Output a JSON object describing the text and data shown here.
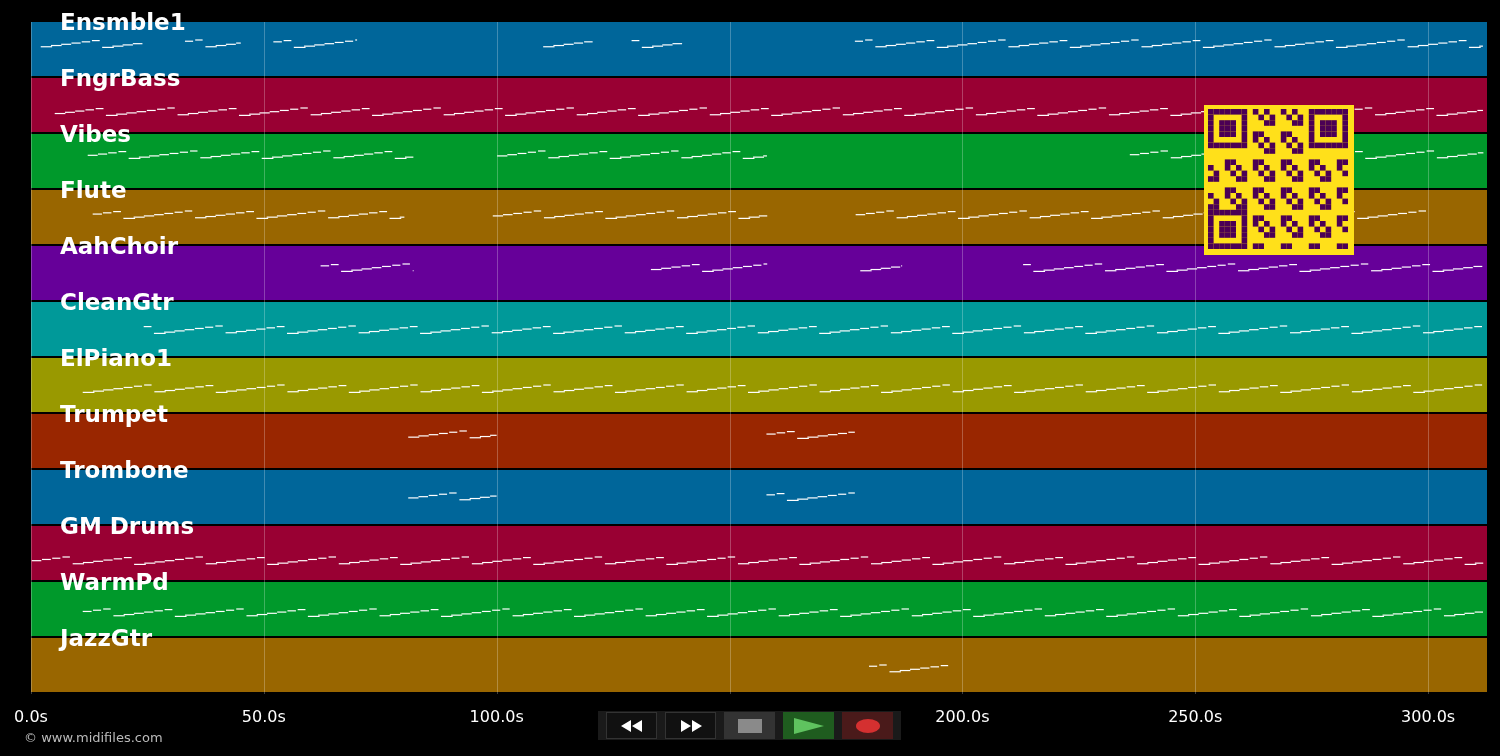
{
  "tracks": [
    {
      "name": "Ensmble1",
      "color": "#00669a"
    },
    {
      "name": "FngrBass",
      "color": "#990033"
    },
    {
      "name": "Vibes",
      "color": "#00992b"
    },
    {
      "name": "Flute",
      "color": "#996600"
    },
    {
      "name": "AahChoir",
      "color": "#660099"
    },
    {
      "name": "CleanGtr",
      "color": "#009999"
    },
    {
      "name": "ElPiano1",
      "color": "#999900"
    },
    {
      "name": "Trumpet",
      "color": "#992600"
    },
    {
      "name": "Trombone",
      "color": "#00669a"
    },
    {
      "name": "GM Drums",
      "color": "#990033"
    },
    {
      "name": "WarmPd",
      "color": "#00992b"
    },
    {
      "name": "JazzGtr",
      "color": "#996600"
    }
  ],
  "time_axis": {
    "ticks": [
      "0.0s",
      "50.0s",
      "100.0s",
      "200.0s",
      "250.0s",
      "300.0s"
    ]
  },
  "copyright": "© www.midifiles.com",
  "transport": [
    {
      "kind": "rewind"
    },
    {
      "kind": "forward"
    },
    {
      "kind": "stop"
    },
    {
      "kind": "play"
    },
    {
      "kind": "record"
    }
  ]
}
